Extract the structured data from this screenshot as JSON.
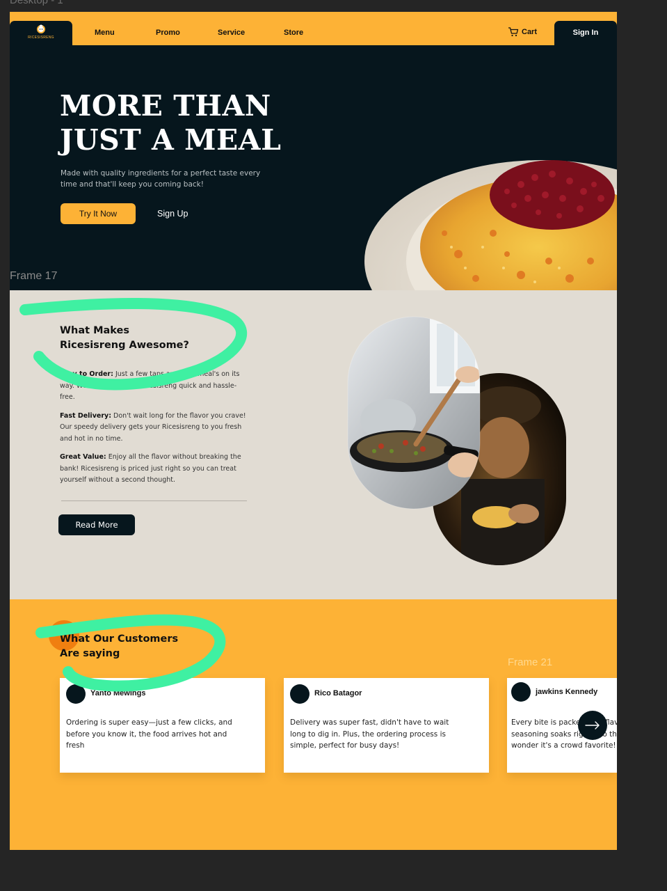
{
  "frames": {
    "top_label": "Desktop - 1",
    "hero_label": "Frame 17",
    "testimonials_label": "Frame 21"
  },
  "brand": {
    "name": "RICESISRENG",
    "accent": "#fdb236",
    "dark": "#06161d"
  },
  "nav": {
    "links": [
      "Menu",
      "Promo",
      "Service",
      "Store"
    ],
    "cart_label": "Cart",
    "signin_label": "Sign In"
  },
  "hero": {
    "title_line1": "MORE THAN",
    "title_line2": "JUST A MEAL",
    "subtitle": "Made with quality ingredients for a perfect taste every time and that'll keep you coming back!",
    "primary_button": "Try It Now",
    "secondary_button": "Sign Up"
  },
  "features": {
    "title_line1": "What Makes",
    "title_line2": "Ricesisreng Awesome?",
    "items": [
      {
        "label": "Easy to Order:",
        "text": " Just a few taps and your meal's on its way. We make ordering Ricesisreng quick and hassle-free."
      },
      {
        "label": "Fast Delivery:",
        "text": " Don't wait long for the flavor you crave! Our speedy delivery gets your Ricesisreng to you fresh and hot in no time."
      },
      {
        "label": "Great Value:",
        "text": " Enjoy all the flavor without breaking the bank! Ricesisreng is priced just right so you can treat yourself without a second thought."
      }
    ],
    "read_more": "Read More"
  },
  "testimonials": {
    "title_line1": "What Our Customers",
    "title_line2": "Are saying",
    "cards": [
      {
        "name": "Yanto Mewings",
        "text": "Ordering is super easy—just a few clicks, and before you know it, the food arrives hot and fresh"
      },
      {
        "name": "Rico Batagor",
        "text": "Delivery was super fast, didn't have to wait long to dig in. Plus, the ordering process is simple, perfect for busy days!"
      },
      {
        "name": "jawkins Kennedy",
        "text": "Every bite is packed with flavor, the seasoning soaks right into the rice, no wonder it's a crowd favorite!"
      }
    ]
  }
}
